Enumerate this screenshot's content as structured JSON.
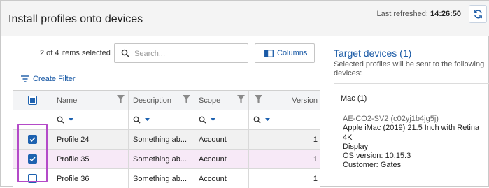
{
  "header": {
    "title": "Install profiles onto devices",
    "last_refreshed_label": "Last refreshed:",
    "last_refreshed_time": "14:26:50",
    "refresh_icon": "refresh-icon"
  },
  "toolbar": {
    "selection_text": "2 of 4 items selected",
    "search_placeholder": "Search...",
    "columns_label": "Columns",
    "create_filter_label": "Create Filter"
  },
  "table": {
    "columns": [
      "Name",
      "Description",
      "Scope",
      "Version"
    ],
    "rows": [
      {
        "checked": true,
        "name": "Profile 24",
        "description": "Something ab...",
        "scope": "Account",
        "version": "1"
      },
      {
        "checked": true,
        "name": "Profile 35",
        "description": "Something ab...",
        "scope": "Account",
        "version": "1"
      },
      {
        "checked": false,
        "name": "Profile 36",
        "description": "Something ab...",
        "scope": "Account",
        "version": "1"
      }
    ]
  },
  "target": {
    "title": "Target devices (1)",
    "description": "Selected profiles will be sent to the following devices:",
    "group_label": "Mac (1)",
    "device": {
      "id": "AE-CO2-SV2 (c02yj1b4jg5j)",
      "model_line1": "Apple iMac (2019) 21.5 Inch with Retina 4K",
      "model_line2": "Display",
      "os": "OS version: 10.15.3",
      "customer": "Customer: Gates"
    }
  },
  "colors": {
    "accent": "#1a5aa6",
    "checkbox": "#1e62b0",
    "highlight_border": "#b44ac8",
    "selected_row": "#f7e9f7"
  }
}
